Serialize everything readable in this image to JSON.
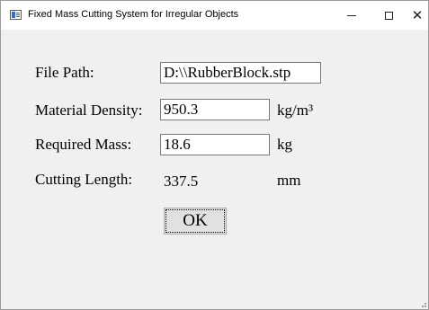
{
  "window": {
    "title": "Fixed Mass Cutting System for Irregular Objects",
    "controls": {
      "minimize": "minimize-icon",
      "maximize": "maximize-icon",
      "close": "close-icon"
    }
  },
  "form": {
    "file_path": {
      "label": "File Path:",
      "value": "D:\\\\RubberBlock.stp"
    },
    "density": {
      "label": "Material Density:",
      "value": "950.3",
      "unit": "kg/m³"
    },
    "mass": {
      "label": "Required Mass:",
      "value": "18.6",
      "unit": "kg"
    },
    "cutting_length": {
      "label": "Cutting Length:",
      "value": "337.5",
      "unit": "mm"
    },
    "ok_label": "OK"
  }
}
